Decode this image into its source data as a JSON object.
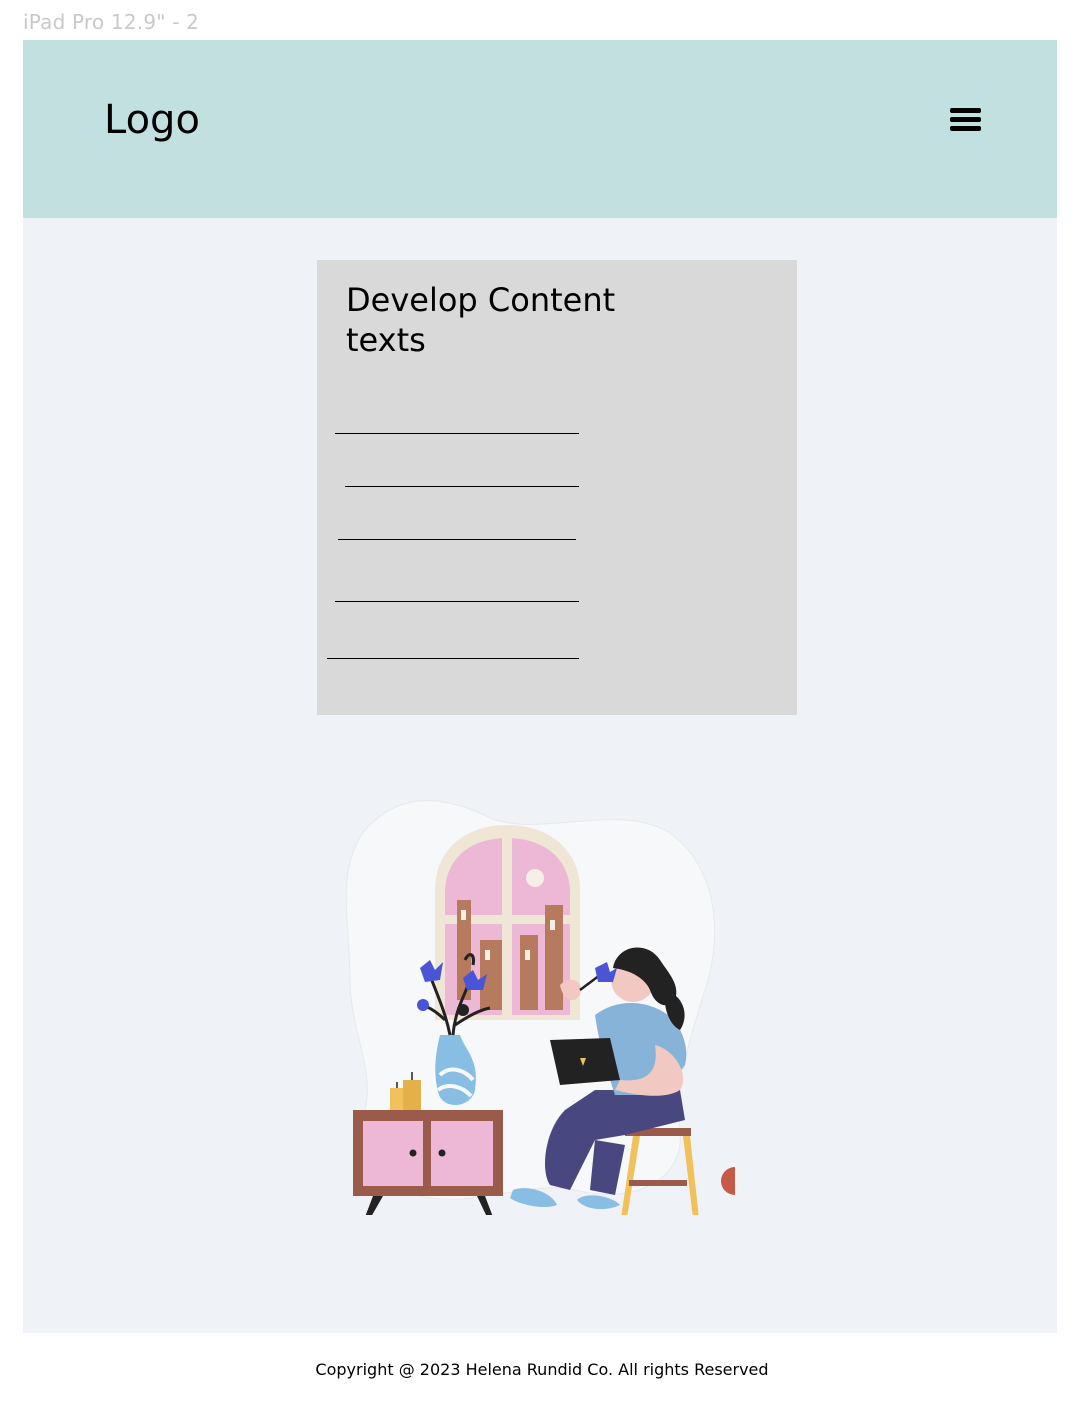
{
  "frame": {
    "label": "iPad Pro 12.9\" - 2"
  },
  "header": {
    "logo_text": "Logo",
    "menu_icon": "hamburger-menu-icon"
  },
  "content_card": {
    "title": "Develop Content texts",
    "placeholder_line_count": 5
  },
  "illustration": {
    "subject": "woman-with-laptop-illustration"
  },
  "footer": {
    "copyright": "Copyright @ 2023 Helena Rundid Co. All rights Reserved"
  },
  "colors": {
    "header_bg": "#c3e0e0",
    "page_bg": "#eff3f8",
    "card_bg": "#d9d9d9",
    "frame_label": "#c9c9c9"
  }
}
